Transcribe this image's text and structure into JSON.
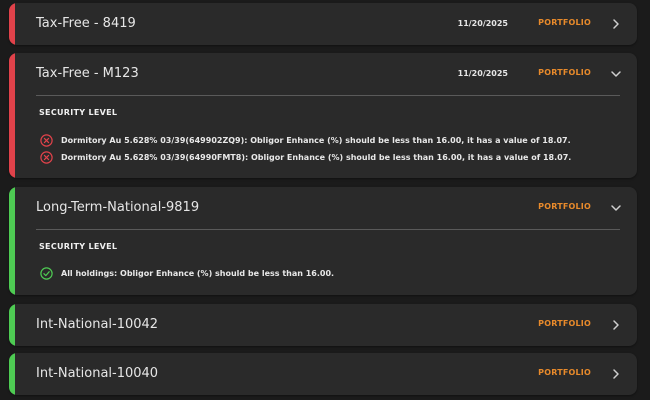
{
  "portfolios": [
    {
      "title": "Tax-Free - 8419",
      "date": "11/20/2025",
      "type": "PORTFOLIO",
      "status": "fail",
      "expanded": false
    },
    {
      "title": "Tax-Free - M123",
      "date": "11/20/2025",
      "type": "PORTFOLIO",
      "status": "fail",
      "expanded": true,
      "section_label": "SECURITY LEVEL",
      "messages": [
        {
          "icon": "error-circle-icon",
          "text": "Dormitory Au 5.628% 03/39(649902ZQ9): Obligor Enhance (%) should be less than 16.00, it has a value of 18.07."
        },
        {
          "icon": "error-circle-icon",
          "text": "Dormitory Au 5.628% 03/39(64990FMT8): Obligor Enhance (%) should be less than 16.00, it has a value of 18.07."
        }
      ]
    },
    {
      "title": "Long-Term-National-9819",
      "date": "",
      "type": "PORTFOLIO",
      "status": "pass",
      "expanded": true,
      "section_label": "SECURITY LEVEL",
      "messages": [
        {
          "icon": "check-circle-icon",
          "text": "All holdings: Obligor Enhance (%) should be less than 16.00."
        }
      ]
    },
    {
      "title": "Int-National-10042",
      "date": "",
      "type": "PORTFOLIO",
      "status": "pass",
      "expanded": false
    },
    {
      "title": "Int-National-10040",
      "date": "",
      "type": "PORTFOLIO",
      "status": "pass",
      "expanded": false
    }
  ],
  "colors": {
    "fail": "#e0424a",
    "pass": "#4ecb53",
    "accent": "#e88a2b",
    "card_bg": "#2a2a2a",
    "page_bg": "#1b1b1b"
  }
}
